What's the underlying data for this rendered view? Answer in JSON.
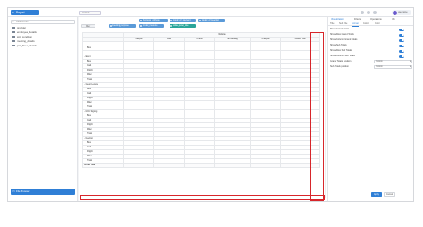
{
  "header": {
    "brand": "Report",
    "tab": "context",
    "user": "username"
  },
  "sidebar": {
    "search_placeholder": "Datasources",
    "items": [
      {
        "label": "provider"
      },
      {
        "label": "employee_details"
      },
      {
        "label": "join_condition"
      },
      {
        "label": "meeting_details"
      },
      {
        "label": "join_three_details"
      }
    ],
    "file_button": "File Browser"
  },
  "fields": {
    "row1": [
      "business_attribute",
      "model_of_payment",
      "model_of_meeting"
    ],
    "row2": [
      "Filter",
      "meeting_purpose",
      "model_measure",
      "value_quiet_date"
    ]
  },
  "table": {
    "group_header": "Website",
    "columns": [
      "Cheque",
      "Cash",
      "Credit",
      "Net Banking",
      "Cheque",
      "Grand Total"
    ],
    "rows": [
      {
        "type": "group",
        "label": "",
        "values": [
          "",
          "",
          "",
          "",
          "",
          ""
        ]
      },
      {
        "type": "item",
        "label": "Bus",
        "values": [
          "",
          "",
          "",
          "",
          "",
          ""
        ]
      },
      {
        "type": "item",
        "label": "",
        "values": [
          "",
          "",
          "",
          "",
          "",
          ""
        ]
      },
      {
        "type": "group",
        "label": "- Event",
        "values": [
          "",
          "",
          "",
          "",
          "",
          ""
        ]
      },
      {
        "type": "item",
        "label": "Bus",
        "values": [
          "",
          "",
          "",
          "",
          "",
          ""
        ]
      },
      {
        "type": "item",
        "label": "Cab",
        "values": [
          "",
          "",
          "",
          "",
          "",
          ""
        ]
      },
      {
        "type": "item",
        "label": "Flight",
        "values": [
          "",
          "",
          "",
          "",
          "",
          ""
        ]
      },
      {
        "type": "item",
        "label": "Misc",
        "values": [
          "",
          "",
          "",
          "",
          "",
          ""
        ]
      },
      {
        "type": "item",
        "label": "Train",
        "values": [
          "",
          "",
          "",
          "",
          "",
          ""
        ]
      },
      {
        "type": "group",
        "label": "- Guest Lecture",
        "values": [
          "",
          "",
          "",
          "",
          "",
          ""
        ]
      },
      {
        "type": "item",
        "label": "Bus",
        "values": [
          "",
          "",
          "",
          "",
          "",
          ""
        ]
      },
      {
        "type": "item",
        "label": "Cab",
        "values": [
          "",
          "",
          "",
          "",
          "",
          ""
        ]
      },
      {
        "type": "item",
        "label": "Flight",
        "values": [
          "",
          "",
          "",
          "",
          "",
          ""
        ]
      },
      {
        "type": "item",
        "label": "Misc",
        "values": [
          "",
          "",
          "",
          "",
          "",
          ""
        ]
      },
      {
        "type": "item",
        "label": "Train",
        "values": [
          "",
          "",
          "",
          "",
          "",
          ""
        ]
      },
      {
        "type": "group",
        "label": "- MOU Signing",
        "values": [
          "",
          "",
          "",
          "",
          "",
          ""
        ]
      },
      {
        "type": "item",
        "label": "Bus",
        "values": [
          "",
          "",
          "",
          "",
          "",
          ""
        ]
      },
      {
        "type": "item",
        "label": "Cab",
        "values": [
          "",
          "",
          "",
          "",
          "",
          ""
        ]
      },
      {
        "type": "item",
        "label": "Flight",
        "values": [
          "",
          "",
          "",
          "",
          "",
          ""
        ]
      },
      {
        "type": "item",
        "label": "Misc",
        "values": [
          "",
          "",
          "",
          "",
          "",
          ""
        ]
      },
      {
        "type": "item",
        "label": "Train",
        "values": [
          "",
          "",
          "",
          "",
          "",
          ""
        ]
      },
      {
        "type": "group",
        "label": "- Meeting",
        "values": [
          "",
          "",
          "",
          "",
          "",
          ""
        ]
      },
      {
        "type": "item",
        "label": "Bus",
        "values": [
          "",
          "",
          "",
          "",
          "",
          ""
        ]
      },
      {
        "type": "item",
        "label": "Cab",
        "values": [
          "",
          "",
          "",
          "",
          "",
          ""
        ]
      },
      {
        "type": "item",
        "label": "Flight",
        "values": [
          "",
          "",
          "",
          "",
          "",
          ""
        ]
      },
      {
        "type": "item",
        "label": "Misc",
        "values": [
          "",
          "",
          "",
          "",
          "",
          ""
        ]
      },
      {
        "type": "item",
        "label": "Train",
        "values": [
          "",
          "",
          "",
          "",
          "",
          ""
        ]
      },
      {
        "type": "grand",
        "label": "Grand Total",
        "values": [
          "",
          "",
          "",
          "",
          "",
          ""
        ]
      }
    ]
  },
  "panel": {
    "tabs": [
      "Visualization",
      "Filters",
      "Operations",
      "Vip"
    ],
    "subtabs": [
      "Title",
      "Sub Title",
      "Format",
      "Colors",
      "Color"
    ],
    "options": [
      {
        "label": "Show Grand Totals",
        "kind": "toggle"
      },
      {
        "label": "Show Row Grand Totals",
        "kind": "toggle"
      },
      {
        "label": "Show Column Grand Totals",
        "kind": "toggle"
      },
      {
        "label": "Show Sub Totals",
        "kind": "toggle"
      },
      {
        "label": "Show Row Sub Totals",
        "kind": "toggle"
      },
      {
        "label": "Show Column Sub Totals",
        "kind": "toggle"
      },
      {
        "label": "Grand Totals position",
        "kind": "select",
        "value": "Bottom"
      },
      {
        "label": "Sub Totals position",
        "kind": "select",
        "value": "Bottom"
      }
    ],
    "apply": "Apply",
    "cancel": "Cancel"
  },
  "colors": {
    "accent": "#2f7fd6",
    "highlight": "#d7262b",
    "teal": "#2aa59a"
  }
}
